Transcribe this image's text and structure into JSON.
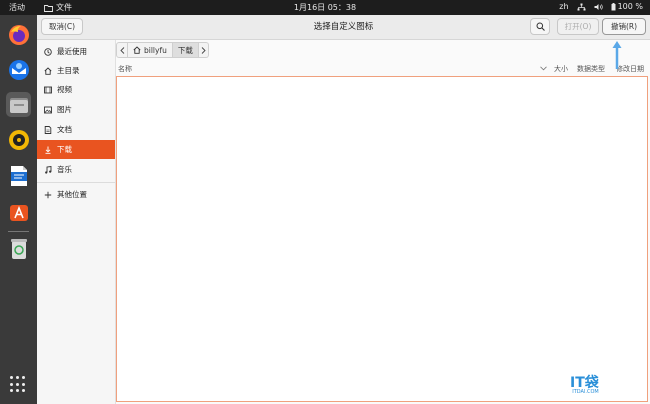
{
  "topbar": {
    "activities": "活动",
    "app_name": "文件",
    "clock": "1月16日  05：38",
    "lang": "zh",
    "battery": "100 %"
  },
  "dialog": {
    "cancel_label": "取消(C)",
    "title": "选择自定义图标",
    "open_label": "打开(O)",
    "revert_label": "撤销(R)"
  },
  "sidebar": {
    "items": [
      {
        "label": "最近使用",
        "icon": "clock-icon"
      },
      {
        "label": "主目录",
        "icon": "home-icon"
      },
      {
        "label": "视频",
        "icon": "video-icon"
      },
      {
        "label": "图片",
        "icon": "image-icon"
      },
      {
        "label": "文档",
        "icon": "document-icon"
      },
      {
        "label": "下载",
        "icon": "download-icon"
      },
      {
        "label": "音乐",
        "icon": "music-icon"
      },
      {
        "label": "其他位置",
        "icon": "plus-icon"
      }
    ]
  },
  "pathbar": {
    "home": "billyfu",
    "current": "下载"
  },
  "columns": {
    "name": "名称",
    "size": "大小",
    "type": "数据类型",
    "modified": "修改日期"
  },
  "watermark": {
    "main": "IT袋",
    "sub": "ITDAI.COM"
  },
  "colors": {
    "accent": "#e95420",
    "annotation": "#2a8fd8"
  }
}
